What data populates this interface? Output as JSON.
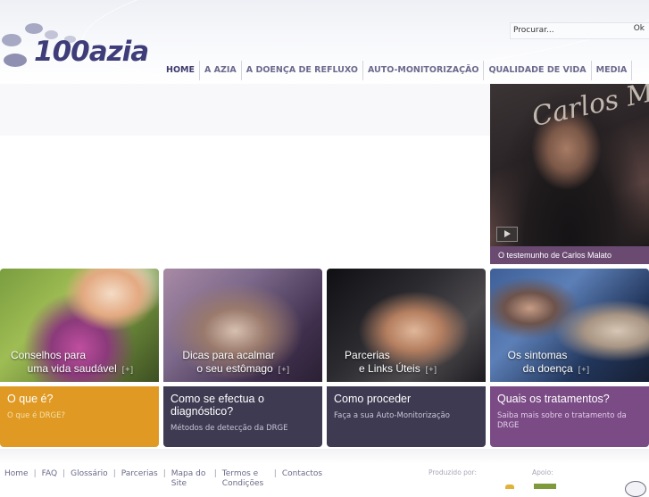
{
  "header": {
    "logo": {
      "prefix": "100",
      "name": "azia"
    },
    "search": {
      "placeholder": "Procurar...",
      "button": "Ok"
    },
    "nav": [
      {
        "label": "HOME",
        "active": true
      },
      {
        "label": "A AZIA"
      },
      {
        "label": "A DOENÇA DE REFLUXO"
      },
      {
        "label": "AUTO-MONITORIZAÇÃO"
      },
      {
        "label": "QUALIDADE DE VIDA"
      },
      {
        "label": "MEDIA"
      }
    ]
  },
  "video": {
    "caption": "O testemunho de Carlos Malato",
    "icon": "play-icon"
  },
  "tiles": [
    {
      "line1": "Conselhos para",
      "line2": "uma vida saudável",
      "more": "[+]"
    },
    {
      "line1": "Dicas para acalmar",
      "line2": "o seu estômago",
      "more": "[+]"
    },
    {
      "line1": "Parcerias",
      "line2": "e Links Úteis",
      "more": "[+]"
    },
    {
      "line1": "Os sintomas",
      "line2": "da doença",
      "more": "[+]"
    }
  ],
  "cards": [
    {
      "title": "O que é?",
      "sub": "O que é DRGE?",
      "color": "#e09a24"
    },
    {
      "title": "Como se efectua o diagnóstico?",
      "sub": "Métodos de detecção da DRGE",
      "color": "#3e3a52"
    },
    {
      "title": "Como proceder",
      "sub": "Faça a sua Auto-Monitorização",
      "color": "#3e3a52"
    },
    {
      "title": "Quais os tratamentos?",
      "sub": "Saiba mais sobre o tratamento da DRGE",
      "color": "#7b4b86"
    }
  ],
  "footer": {
    "links": [
      "Home",
      "FAQ",
      "Glossário",
      "Parcerias",
      "Mapa do Site",
      "Termos e Condições",
      "Contactos"
    ],
    "separator": "|",
    "produced_by": "Produzido por:",
    "support": "Apoio:"
  }
}
